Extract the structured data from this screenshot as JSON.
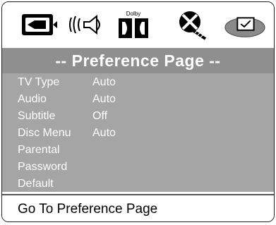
{
  "icons": [
    {
      "name": "system-setup-icon",
      "label": ""
    },
    {
      "name": "audio-setup-icon",
      "label": ""
    },
    {
      "name": "dolby-digital-icon",
      "label": "Dolby"
    },
    {
      "name": "video-setup-icon",
      "label": ""
    },
    {
      "name": "preference-icon",
      "label": ""
    }
  ],
  "title": "-- Preference Page --",
  "menu": [
    {
      "label": "TV Type",
      "value": "Auto"
    },
    {
      "label": "Audio",
      "value": "Auto"
    },
    {
      "label": "Subtitle",
      "value": "Off"
    },
    {
      "label": "Disc Menu",
      "value": "Auto"
    },
    {
      "label": "Parental",
      "value": ""
    },
    {
      "label": "Password",
      "value": ""
    },
    {
      "label": "Default",
      "value": ""
    }
  ],
  "status": "Go To Preference Page",
  "colors": {
    "title_bar": "#8f8f8f",
    "menu_bg": "#a5a5a5",
    "selected_icon": "#8a8a8a"
  }
}
